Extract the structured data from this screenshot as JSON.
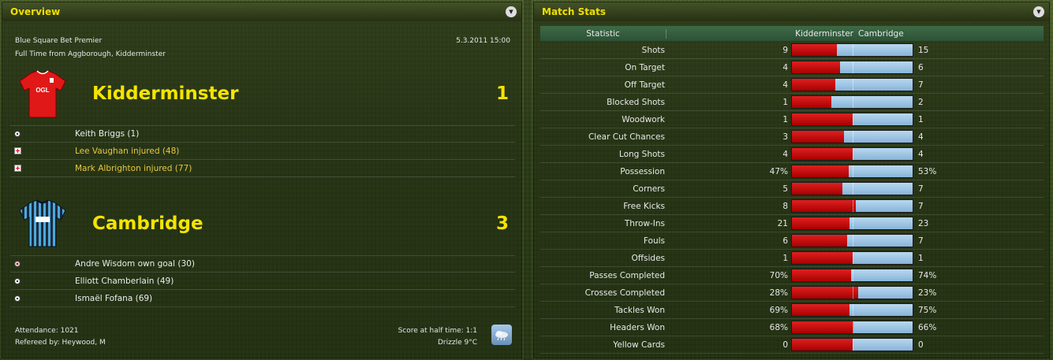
{
  "overview": {
    "title": "Overview",
    "competition": "Blue Square Bet Premier",
    "date": "5.3.2011 15:00",
    "venue": "Full Time from Aggborough, Kidderminster",
    "home": {
      "name": "Kidderminster",
      "score": "1",
      "kit_color": "#e01818",
      "events": [
        {
          "icon": "goal-ball-icon",
          "text": "Keith Briggs (1)",
          "style": "white"
        },
        {
          "icon": "injury-icon",
          "text": "Lee Vaughan injured (48)",
          "style": "yellow"
        },
        {
          "icon": "injury-icon",
          "text": "Mark Albrighton injured (77)",
          "style": "yellow"
        }
      ]
    },
    "away": {
      "name": "Cambridge",
      "score": "3",
      "kit_color": "#3a9ad0",
      "events": [
        {
          "icon": "own-goal-ball-icon",
          "text": "Andre Wisdom own goal (30)",
          "style": "white"
        },
        {
          "icon": "goal-ball-icon",
          "text": "Elliott Chamberlain (49)",
          "style": "white"
        },
        {
          "icon": "goal-ball-icon",
          "text": "Ismaël Fofana (69)",
          "style": "white"
        }
      ]
    },
    "attendance": "Attendance: 1021",
    "referee": "Refereed by: Heywood, M",
    "half_time": "Score at half time: 1:1",
    "weather": "Drizzle 9°C",
    "weather_icon": "rain-cloud-icon"
  },
  "stats": {
    "title": "Match Stats",
    "headers": {
      "statistic": "Statistic",
      "home": "Kidderminster",
      "away": "Cambridge"
    },
    "colors": {
      "home": "#d01010",
      "away": "#a0c8e8"
    },
    "rows": [
      {
        "label": "Shots",
        "home": "9",
        "away": "15",
        "home_share": 0.375
      },
      {
        "label": "On Target",
        "home": "4",
        "away": "6",
        "home_share": 0.4
      },
      {
        "label": "Off Target",
        "home": "4",
        "away": "7",
        "home_share": 0.36
      },
      {
        "label": "Blocked Shots",
        "home": "1",
        "away": "2",
        "home_share": 0.33
      },
      {
        "label": "Woodwork",
        "home": "1",
        "away": "1",
        "home_share": 0.5
      },
      {
        "label": "Clear Cut Chances",
        "home": "3",
        "away": "4",
        "home_share": 0.43
      },
      {
        "label": "Long Shots",
        "home": "4",
        "away": "4",
        "home_share": 0.5
      },
      {
        "label": "Possession",
        "home": "47%",
        "away": "53%",
        "home_share": 0.47
      },
      {
        "label": "Corners",
        "home": "5",
        "away": "7",
        "home_share": 0.42
      },
      {
        "label": "Free Kicks",
        "home": "8",
        "away": "7",
        "home_share": 0.53
      },
      {
        "label": "Throw-Ins",
        "home": "21",
        "away": "23",
        "home_share": 0.48
      },
      {
        "label": "Fouls",
        "home": "6",
        "away": "7",
        "home_share": 0.46
      },
      {
        "label": "Offsides",
        "home": "1",
        "away": "1",
        "home_share": 0.5
      },
      {
        "label": "Passes Completed",
        "home": "70%",
        "away": "74%",
        "home_share": 0.49
      },
      {
        "label": "Crosses Completed",
        "home": "28%",
        "away": "23%",
        "home_share": 0.55
      },
      {
        "label": "Tackles Won",
        "home": "69%",
        "away": "75%",
        "home_share": 0.48
      },
      {
        "label": "Headers Won",
        "home": "68%",
        "away": "66%",
        "home_share": 0.51
      },
      {
        "label": "Yellow Cards",
        "home": "0",
        "away": "0",
        "home_share": 0.5
      }
    ]
  }
}
